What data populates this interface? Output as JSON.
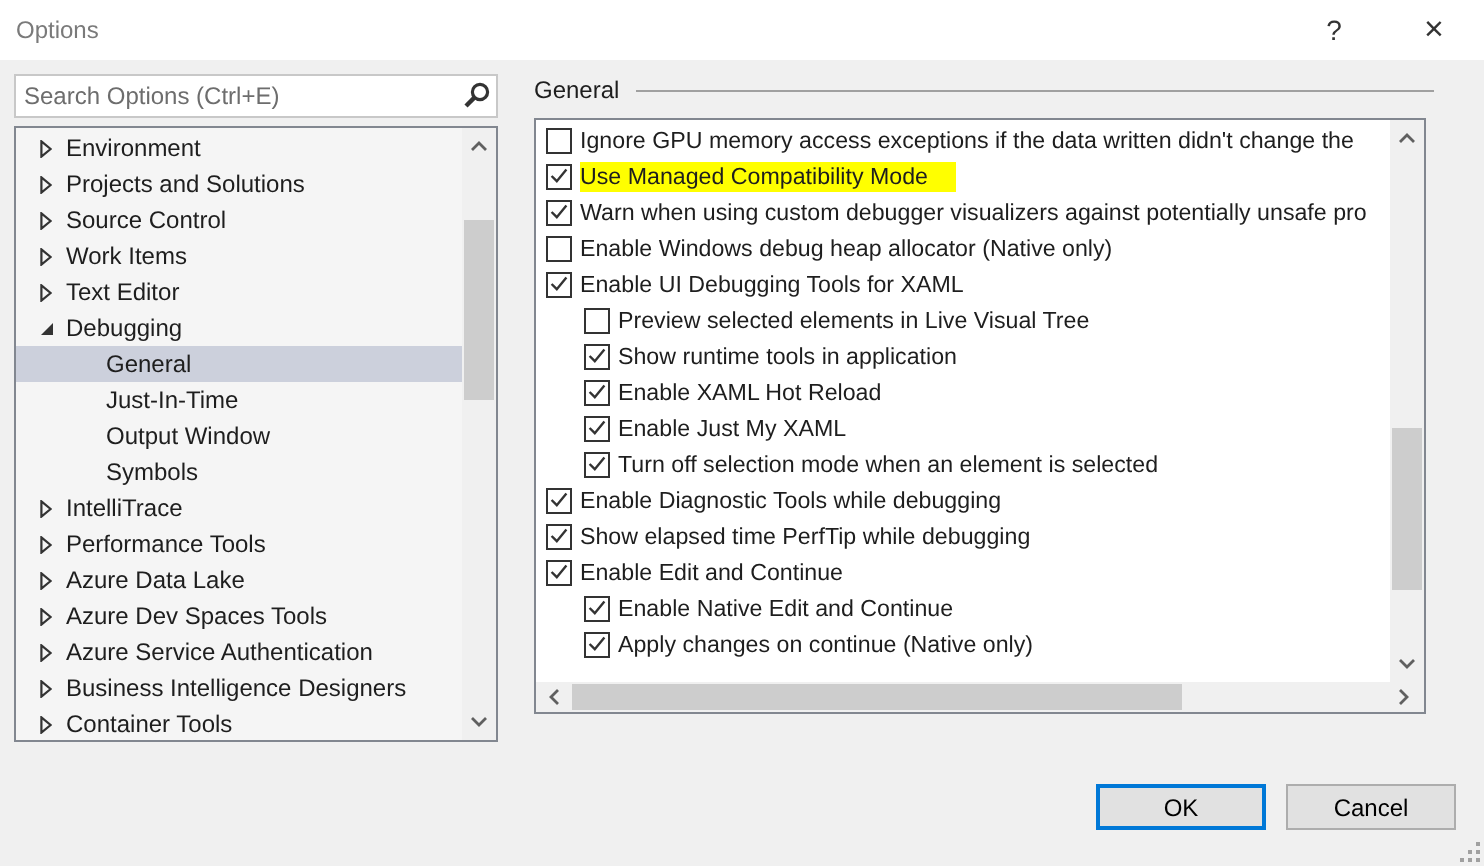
{
  "window": {
    "title": "Options",
    "help": "?",
    "close": "×"
  },
  "search": {
    "placeholder": "Search Options (Ctrl+E)"
  },
  "tree": [
    {
      "label": "Environment",
      "expanded": false,
      "selected": false
    },
    {
      "label": "Projects and Solutions",
      "expanded": false,
      "selected": false
    },
    {
      "label": "Source Control",
      "expanded": false,
      "selected": false
    },
    {
      "label": "Work Items",
      "expanded": false,
      "selected": false
    },
    {
      "label": "Text Editor",
      "expanded": false,
      "selected": false
    },
    {
      "label": "Debugging",
      "expanded": true,
      "selected": false,
      "children": [
        {
          "label": "General",
          "selected": true
        },
        {
          "label": "Just-In-Time",
          "selected": false
        },
        {
          "label": "Output Window",
          "selected": false
        },
        {
          "label": "Symbols",
          "selected": false
        }
      ]
    },
    {
      "label": "IntelliTrace",
      "expanded": false,
      "selected": false
    },
    {
      "label": "Performance Tools",
      "expanded": false,
      "selected": false
    },
    {
      "label": "Azure Data Lake",
      "expanded": false,
      "selected": false
    },
    {
      "label": "Azure Dev Spaces Tools",
      "expanded": false,
      "selected": false
    },
    {
      "label": "Azure Service Authentication",
      "expanded": false,
      "selected": false
    },
    {
      "label": "Business Intelligence Designers",
      "expanded": false,
      "selected": false
    },
    {
      "label": "Container Tools",
      "expanded": false,
      "selected": false
    }
  ],
  "section_title": "General",
  "options": [
    {
      "label": "Ignore GPU memory access exceptions if the data written didn't change the",
      "checked": false,
      "highlighted": false
    },
    {
      "label": "Use Managed Compatibility Mode",
      "checked": true,
      "highlighted": true
    },
    {
      "label": "Warn when using custom debugger visualizers against potentially unsafe pro",
      "checked": true,
      "highlighted": false
    },
    {
      "label": "Enable Windows debug heap allocator (Native only)",
      "checked": false,
      "highlighted": false
    },
    {
      "label": "Enable UI Debugging Tools for XAML",
      "checked": true,
      "highlighted": false,
      "children": [
        {
          "label": "Preview selected elements in Live Visual Tree",
          "checked": false,
          "highlighted": false
        },
        {
          "label": "Show runtime tools in application",
          "checked": true,
          "highlighted": false
        },
        {
          "label": "Enable XAML Hot Reload",
          "checked": true,
          "highlighted": false
        },
        {
          "label": "Enable Just My XAML",
          "checked": true,
          "highlighted": false
        },
        {
          "label": "Turn off selection mode when an element is selected",
          "checked": true,
          "highlighted": false
        }
      ]
    },
    {
      "label": "Enable Diagnostic Tools while debugging",
      "checked": true,
      "highlighted": false
    },
    {
      "label": "Show elapsed time PerfTip while debugging",
      "checked": true,
      "highlighted": false
    },
    {
      "label": "Enable Edit and Continue",
      "checked": true,
      "highlighted": false,
      "children": [
        {
          "label": "Enable Native Edit and Continue",
          "checked": true,
          "highlighted": false
        },
        {
          "label": "Apply changes on continue (Native only)",
          "checked": true,
          "highlighted": false
        }
      ]
    }
  ],
  "buttons": [
    {
      "label": "OK",
      "default": true
    },
    {
      "label": "Cancel",
      "default": false
    }
  ]
}
